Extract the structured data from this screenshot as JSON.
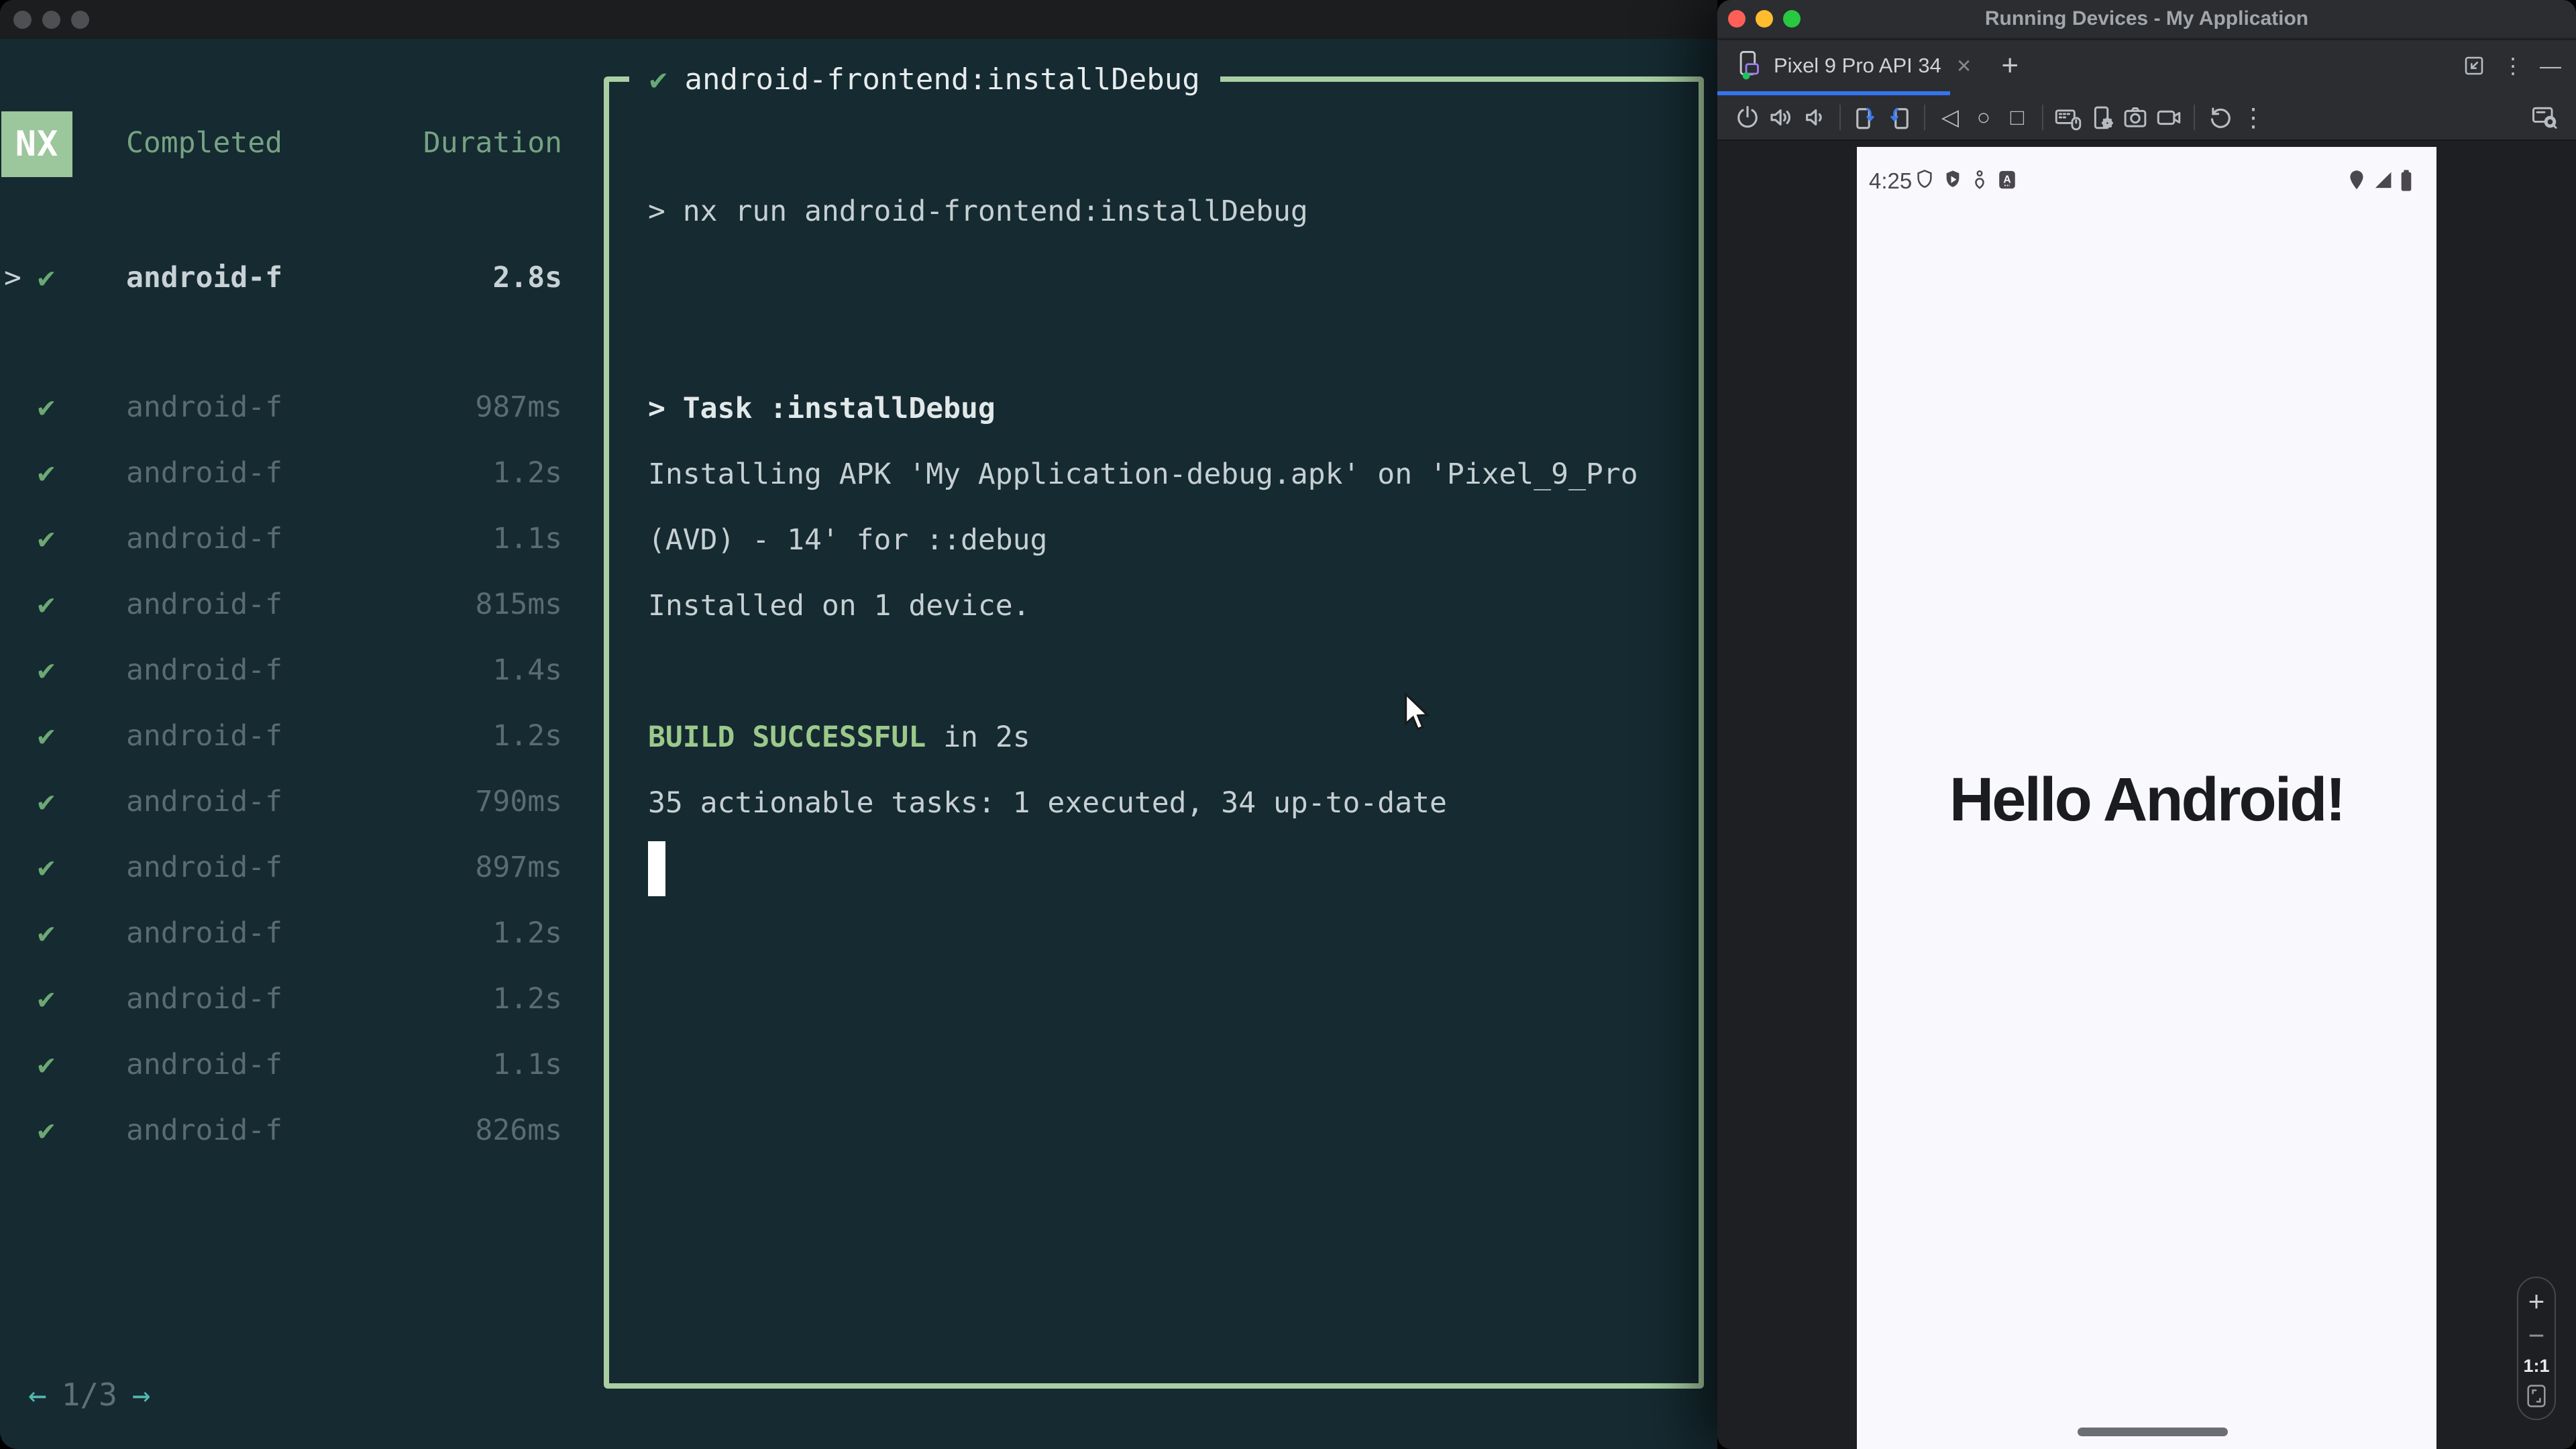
{
  "terminal": {
    "sidebar": {
      "logo": "NX",
      "columns": {
        "completed": "Completed",
        "duration": "Duration"
      },
      "chevron_glyph": ">",
      "check_glyph": "✔",
      "selected": {
        "name": "android-f",
        "duration": "2.8s"
      },
      "tasks": [
        {
          "name": "android-f",
          "duration": "987ms"
        },
        {
          "name": "android-f",
          "duration": "1.2s"
        },
        {
          "name": "android-f",
          "duration": "1.1s"
        },
        {
          "name": "android-f",
          "duration": "815ms"
        },
        {
          "name": "android-f",
          "duration": "1.4s"
        },
        {
          "name": "android-f",
          "duration": "1.2s"
        },
        {
          "name": "android-f",
          "duration": "790ms"
        },
        {
          "name": "android-f",
          "duration": "897ms"
        },
        {
          "name": "android-f",
          "duration": "1.2s"
        },
        {
          "name": "android-f",
          "duration": "1.2s"
        },
        {
          "name": "android-f",
          "duration": "1.1s"
        },
        {
          "name": "android-f",
          "duration": "826ms"
        }
      ],
      "pagination": {
        "prev": "←",
        "page": "1/3",
        "next": "→"
      }
    },
    "output": {
      "check_glyph": "✔",
      "title": "android-frontend:installDebug",
      "cmd_line": "> nx run android-frontend:installDebug",
      "task_line": "> Task :installDebug",
      "install_line1": "Installing APK 'My Application-debug.apk' on 'Pixel_9_Pro",
      "install_line2": "(AVD) - 14' for ::debug",
      "install_line3": "Installed on 1 device.",
      "build_status": "BUILD SUCCESSFUL",
      "build_suffix": "in 2s",
      "summary_line": "35 actionable tasks: 1 executed, 34 up-to-date"
    }
  },
  "android_studio": {
    "window_title": "Running Devices - My Application",
    "tab": {
      "label": "Pixel 9 Pro API 34",
      "close_glyph": "✕",
      "add_glyph": "+",
      "more_glyph": "⋮",
      "minimize_glyph": "—"
    },
    "toolbar": {
      "back_glyph": "◁",
      "home_glyph": "○",
      "overview_glyph": "□",
      "more_glyph": "⋮"
    },
    "emulator": {
      "status": {
        "time": "4:25"
      },
      "greeting": "Hello Android!",
      "zoom_controls": {
        "zoom_in": "+",
        "zoom_out": "−",
        "actual_ratio": "1:1"
      }
    },
    "colors": {
      "accent_blue": "#3574f0",
      "border_green": "#a9cfa3",
      "build_green": "#9cc98b",
      "check_green": "#6da874",
      "nx_logo_green": "#9cc69b",
      "terminal_bg": "#152a31"
    }
  }
}
